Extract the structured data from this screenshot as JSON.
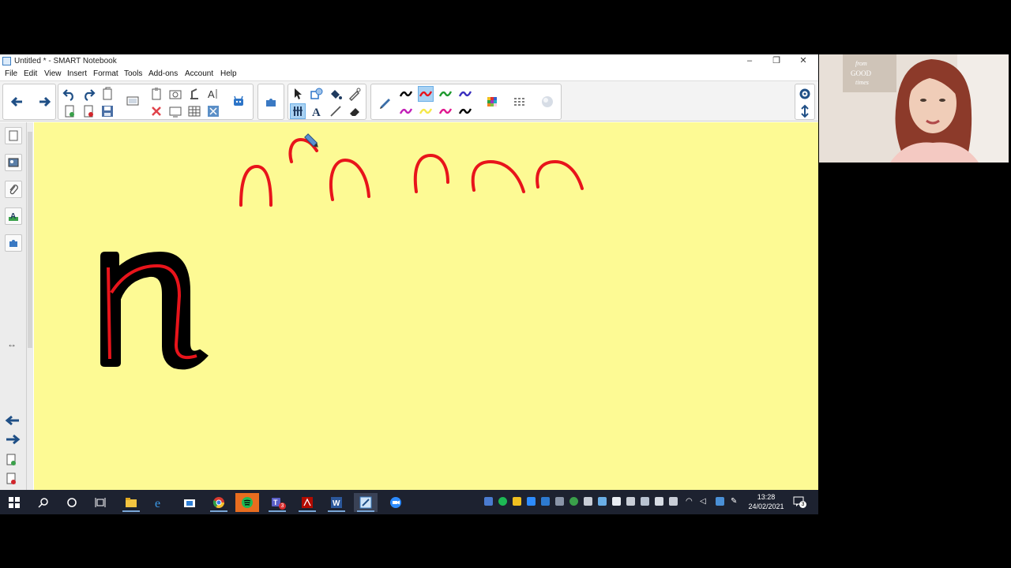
{
  "window": {
    "title": "Untitled * - SMART Notebook",
    "minimize": "–",
    "restore": "❐",
    "close": "✕"
  },
  "menu": [
    "File",
    "Edit",
    "View",
    "Insert",
    "Format",
    "Tools",
    "Add-ons",
    "Account",
    "Help"
  ],
  "toolbar": {
    "pen_colors": [
      "#000000",
      "#e8141b",
      "#1f9a2f",
      "#3a2fbf",
      "#c21fb8",
      "#f5e84a",
      "#e0178e",
      "#000000"
    ],
    "selected_pen_color": "#e8141b",
    "accent": "#a9d2f3"
  },
  "canvas": {
    "background": "#fdfa94",
    "stroke_color": "#e8141b",
    "letter": "n",
    "letter_outline": "#000000",
    "letter_inner": "#e8141b"
  },
  "taskbar": {
    "time": "13:28",
    "date": "24/02/2021",
    "teams_badge": "3",
    "notification_count": "3"
  },
  "webcam": {
    "sign_text": "from GOOD times"
  }
}
